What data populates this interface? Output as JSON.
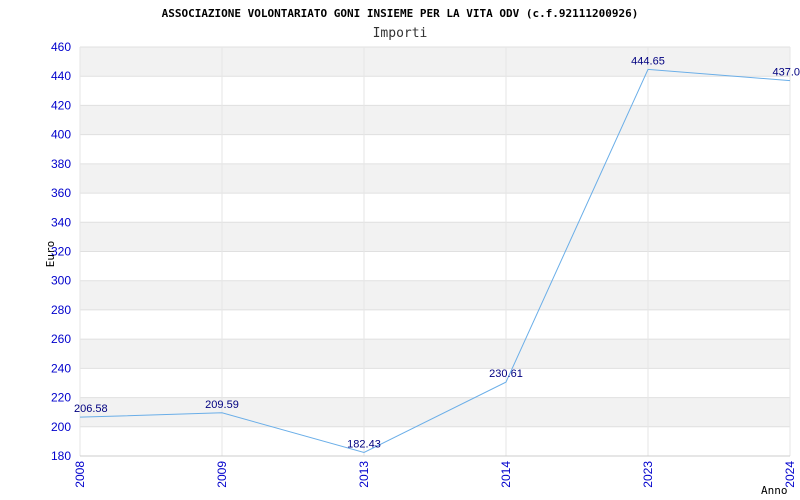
{
  "chart_data": {
    "type": "line",
    "title": "ASSOCIAZIONE VOLONTARIATO GONI INSIEME PER LA VITA ODV (c.f.92111200926)",
    "subtitle": "Importi",
    "xlabel": "Anno",
    "ylabel": "Euro",
    "categories": [
      "2008",
      "2009",
      "2013",
      "2014",
      "2023",
      "2024"
    ],
    "values": [
      206.58,
      209.59,
      182.43,
      230.61,
      444.65,
      437.0
    ],
    "value_labels": [
      "206.58",
      "209.59",
      "182.43",
      "230.61",
      "444.65",
      "437.0"
    ],
    "ylim": [
      180,
      460
    ],
    "yticks": [
      "180",
      "200",
      "220",
      "240",
      "260",
      "280",
      "300",
      "320",
      "340",
      "360",
      "380",
      "400",
      "420",
      "440",
      "460"
    ],
    "grid": true,
    "colors": {
      "line": "#6aaee8",
      "band": "#f2f2f2",
      "tick_text": "#0000cc",
      "value_text": "#000080"
    }
  }
}
